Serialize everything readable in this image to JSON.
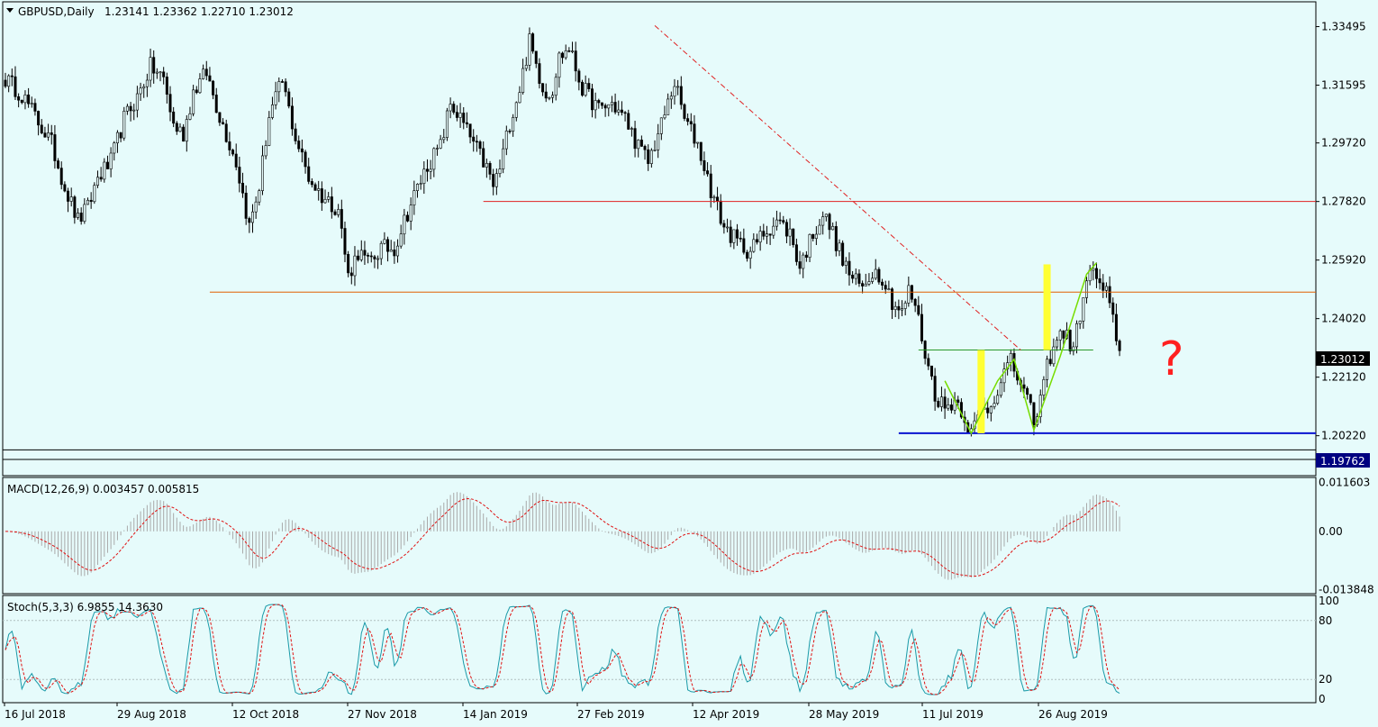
{
  "colors": {
    "background": "#e6fbfb",
    "candle": "#000000",
    "frame": "#000000",
    "grid_text": "#000000",
    "macd_hist": "#a9a9a9",
    "signal": "#e01010",
    "stoch_main": "#1a9aa8",
    "stoch_signal": "#e01010",
    "resistance": "#e02020",
    "support_orange": "#e06000",
    "support_blue": "#0a14d0",
    "neckline": "#2a9a2a",
    "yellow_marks": "#ffff33",
    "pattern_lines": "#77dd00",
    "question": "#ff2020",
    "price_tag_bg": "#000080",
    "price_tag_text": "#ffffff"
  },
  "header": {
    "symbol": "GBPUSD,Daily",
    "ohlc": "1.23141 1.23362 1.22710 1.23012"
  },
  "annotation": {
    "question_mark": "?"
  },
  "chart_data": [
    {
      "type": "candlestick",
      "title": "GBPUSD,Daily  1.23141 1.23362 1.22710 1.23012",
      "ylim": [
        1.1945,
        1.343
      ],
      "y_ticks": [
        "1.33495",
        "1.31595",
        "1.29720",
        "1.27820",
        "1.25920",
        "1.24020",
        "1.22120",
        "1.20220"
      ],
      "y_tick_values": [
        1.33495,
        1.31595,
        1.2972,
        1.2782,
        1.2592,
        1.2402,
        1.2212,
        1.2022
      ],
      "current_price_label": "1.23012",
      "current_price": 1.23012,
      "lower_price_label": "1.19762",
      "lower_price": 1.19762,
      "x_labels": [
        "16 Jul 2018",
        "29 Aug 2018",
        "12 Oct 2018",
        "27 Nov 2018",
        "14 Jan 2019",
        "27 Feb 2019",
        "12 Apr 2019",
        "28 May 2019",
        "11 Jul 2019",
        "26 Aug 2019"
      ],
      "close_path": [
        [
          0,
          1.318
        ],
        [
          5,
          1.313
        ],
        [
          10,
          1.304
        ],
        [
          14,
          1.297
        ],
        [
          18,
          1.283
        ],
        [
          22,
          1.272
        ],
        [
          25,
          1.276
        ],
        [
          28,
          1.286
        ],
        [
          32,
          1.291
        ],
        [
          36,
          1.305
        ],
        [
          40,
          1.312
        ],
        [
          44,
          1.322
        ],
        [
          48,
          1.318
        ],
        [
          51,
          1.303
        ],
        [
          54,
          1.3
        ],
        [
          57,
          1.314
        ],
        [
          61,
          1.32
        ],
        [
          65,
          1.306
        ],
        [
          70,
          1.291
        ],
        [
          74,
          1.27
        ],
        [
          77,
          1.283
        ],
        [
          80,
          1.306
        ],
        [
          84,
          1.317
        ],
        [
          88,
          1.299
        ],
        [
          92,
          1.286
        ],
        [
          96,
          1.28
        ],
        [
          101,
          1.276
        ],
        [
          104,
          1.254
        ],
        [
          107,
          1.262
        ],
        [
          110,
          1.258
        ],
        [
          114,
          1.263
        ],
        [
          118,
          1.263
        ],
        [
          121,
          1.272
        ],
        [
          124,
          1.28
        ],
        [
          128,
          1.29
        ],
        [
          132,
          1.296
        ],
        [
          135,
          1.31
        ],
        [
          138,
          1.305
        ],
        [
          140,
          1.301
        ],
        [
          143,
          1.295
        ],
        [
          146,
          1.289
        ],
        [
          148,
          1.283
        ],
        [
          150,
          1.289
        ],
        [
          153,
          1.304
        ],
        [
          156,
          1.315
        ],
        [
          159,
          1.33
        ],
        [
          162,
          1.319
        ],
        [
          164,
          1.313
        ],
        [
          166,
          1.315
        ],
        [
          168,
          1.325
        ],
        [
          171,
          1.328
        ],
        [
          175,
          1.315
        ],
        [
          180,
          1.308
        ],
        [
          184,
          1.31
        ],
        [
          188,
          1.305
        ],
        [
          192,
          1.296
        ],
        [
          195,
          1.291
        ],
        [
          199,
          1.303
        ],
        [
          203,
          1.317
        ],
        [
          206,
          1.305
        ],
        [
          210,
          1.297
        ],
        [
          214,
          1.282
        ],
        [
          218,
          1.27
        ],
        [
          222,
          1.265
        ],
        [
          226,
          1.262
        ],
        [
          230,
          1.268
        ],
        [
          234,
          1.272
        ],
        [
          238,
          1.268
        ],
        [
          241,
          1.257
        ],
        [
          245,
          1.268
        ],
        [
          248,
          1.274
        ],
        [
          251,
          1.268
        ],
        [
          254,
          1.259
        ],
        [
          257,
          1.253
        ],
        [
          260,
          1.25
        ],
        [
          263,
          1.256
        ],
        [
          266,
          1.254
        ],
        [
          269,
          1.246
        ],
        [
          272,
          1.242
        ],
        [
          274,
          1.249
        ],
        [
          276,
          1.245
        ],
        [
          279,
          1.229
        ],
        [
          282,
          1.216
        ],
        [
          285,
          1.211
        ],
        [
          288,
          1.214
        ],
        [
          290,
          1.211
        ],
        [
          293,
          1.203
        ],
        [
          296,
          1.21
        ],
        [
          299,
          1.212
        ],
        [
          302,
          1.221
        ],
        [
          305,
          1.226
        ],
        [
          308,
          1.219
        ],
        [
          311,
          1.21
        ],
        [
          313,
          1.207
        ],
        [
          315,
          1.221
        ],
        [
          318,
          1.232
        ],
        [
          321,
          1.236
        ],
        [
          324,
          1.23
        ],
        [
          327,
          1.248
        ],
        [
          330,
          1.257
        ],
        [
          332,
          1.25
        ],
        [
          334,
          1.248
        ],
        [
          337,
          1.235
        ],
        [
          338,
          1.23
        ]
      ],
      "horizontal_levels": [
        {
          "price": 1.2782,
          "from_bar": 145,
          "color": "resistance"
        },
        {
          "price": 1.2488,
          "from_bar": 62,
          "color": "support_orange"
        },
        {
          "price": 1.203,
          "from_bar": 271,
          "color": "support_blue"
        },
        {
          "price": 1.23,
          "from_bar": 277,
          "to_bar": 330,
          "color": "neckline"
        }
      ],
      "trendline": {
        "from": [
          197,
          1.3353
        ],
        "to": [
          308,
          1.23
        ]
      },
      "yellow_bars": [
        {
          "bar": 296,
          "low": 1.203,
          "high": 1.23
        },
        {
          "bar": 316,
          "low": 1.23,
          "high": 1.2578
        }
      ],
      "pattern_polyline": [
        [
          285,
          1.22
        ],
        [
          293,
          1.203
        ],
        [
          301,
          1.22
        ],
        [
          306,
          1.227
        ],
        [
          312,
          1.204
        ],
        [
          320,
          1.228
        ],
        [
          328,
          1.2546
        ],
        [
          331,
          1.2583
        ]
      ]
    },
    {
      "type": "line",
      "title": "MACD(12,26,9) 0.003457 0.005815",
      "ylim": [
        -0.0148,
        0.0128
      ],
      "y_ticks": [
        "0.011603",
        "0.00",
        "-0.013848"
      ],
      "y_tick_values": [
        0.011603,
        0.0,
        -0.013848
      ],
      "last_macd": 0.003457,
      "last_signal": 0.005815
    },
    {
      "type": "line",
      "title": "Stoch(5,3,3) 6.9855 14.3630",
      "ylim": [
        0,
        100
      ],
      "y_ticks": [
        "100",
        "80",
        "20",
        "0"
      ],
      "y_tick_values": [
        100,
        80,
        20,
        0
      ],
      "last_main": 6.9855,
      "last_signal": 14.363
    }
  ]
}
